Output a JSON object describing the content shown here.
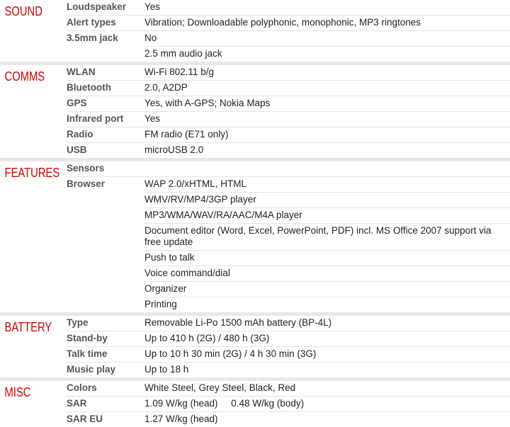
{
  "sections": [
    {
      "title": "SOUND",
      "rows": [
        {
          "key": "Loudspeaker",
          "value": "Yes"
        },
        {
          "key": "Alert types",
          "value": "Vibration; Downloadable polyphonic, monophonic, MP3 ringtones"
        },
        {
          "key": "3.5mm jack",
          "value": "No"
        },
        {
          "key": "",
          "value": "2.5 mm audio jack"
        }
      ]
    },
    {
      "title": "COMMS",
      "rows": [
        {
          "key": "WLAN",
          "value": "Wi-Fi 802.11 b/g"
        },
        {
          "key": "Bluetooth",
          "value": "2.0, A2DP"
        },
        {
          "key": "GPS",
          "value": "Yes, with A-GPS; Nokia Maps"
        },
        {
          "key": "Infrared port",
          "value": "Yes"
        },
        {
          "key": "Radio",
          "value": "FM radio (E71 only)"
        },
        {
          "key": "USB",
          "value": "microUSB 2.0"
        }
      ]
    },
    {
      "title": "FEATURES",
      "rows": [
        {
          "key": "Sensors",
          "value": ""
        },
        {
          "key": "Browser",
          "value": "WAP 2.0/xHTML, HTML"
        },
        {
          "key": "",
          "value": "WMV/RV/MP4/3GP player"
        },
        {
          "key": "",
          "value": "MP3/WMA/WAV/RA/AAC/M4A player"
        },
        {
          "key": "",
          "value": "Document editor (Word, Excel, PowerPoint, PDF) incl. MS Office 2007 support via free update"
        },
        {
          "key": "",
          "value": "Push to talk"
        },
        {
          "key": "",
          "value": "Voice command/dial"
        },
        {
          "key": "",
          "value": "Organizer"
        },
        {
          "key": "",
          "value": "Printing"
        }
      ]
    },
    {
      "title": "BATTERY",
      "rows": [
        {
          "key": "Type",
          "value": "Removable Li-Po 1500 mAh battery (BP-4L)"
        },
        {
          "key": "Stand-by",
          "value": "Up to 410 h (2G) / 480 h (3G)"
        },
        {
          "key": "Talk time",
          "value": "Up to 10 h 30 min (2G) / 4 h 30 min (3G)"
        },
        {
          "key": "Music play",
          "value": "Up to 18 h"
        }
      ]
    },
    {
      "title": "MISC",
      "rows": [
        {
          "key": "Colors",
          "value": "White Steel, Grey Steel, Black, Red"
        },
        {
          "key": "SAR",
          "value": "1.09 W/kg (head)     0.48 W/kg (body)"
        },
        {
          "key": "SAR EU",
          "value": "1.27 W/kg (head)"
        }
      ]
    }
  ]
}
